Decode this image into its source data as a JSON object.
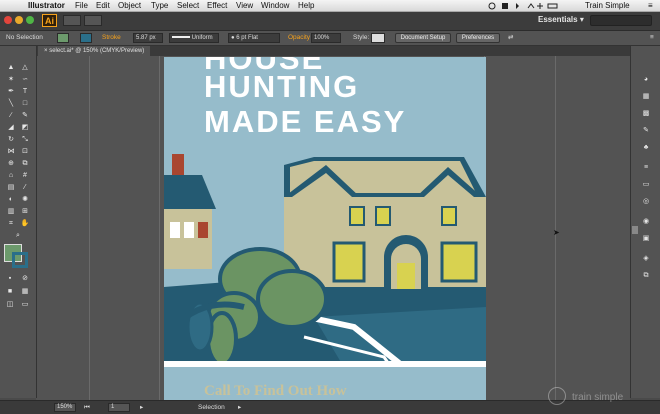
{
  "menubar": {
    "apple_glyph": "",
    "app_name": "Illustrator",
    "items": [
      "File",
      "Edit",
      "Object",
      "Type",
      "Select",
      "Effect",
      "View",
      "Window",
      "Help"
    ],
    "user": "Train Simple"
  },
  "appbar": {
    "logo": "Ai",
    "workspace": "Essentials",
    "workspace_arrow": "▾"
  },
  "controlbar": {
    "selection_label": "No Selection",
    "stroke_label": "Stroke",
    "stroke_weight": "5.87 px",
    "profile": "Uniform",
    "brush": "6 pt Flat",
    "opacity_label": "Opacity",
    "opacity_value": "100%",
    "style_label": "Style:",
    "document_setup": "Document Setup",
    "preferences": "Preferences"
  },
  "document": {
    "tab_title": "select.ai* @ 150% (CMYK/Preview)",
    "close_glyph": "×"
  },
  "artwork": {
    "headline_partial": "HOUSE",
    "headline_line2": "HUNTING",
    "headline_line3": "MADE EASY",
    "cta": "Call To Find Out How"
  },
  "statusbar": {
    "zoom": "150%",
    "page": "1",
    "mode": "Selection"
  },
  "watermark": "train simple",
  "colors": {
    "accent": "#f7a21b",
    "sky": "#96bccb",
    "navy": "#245a72",
    "cream": "#c8c29a",
    "tree_green": "#6b9463",
    "window_yellow": "#d8d250",
    "chimney_red": "#a94630",
    "fill_swatch": "#6c9a6c",
    "stroke_swatch": "#2a6f8a"
  }
}
